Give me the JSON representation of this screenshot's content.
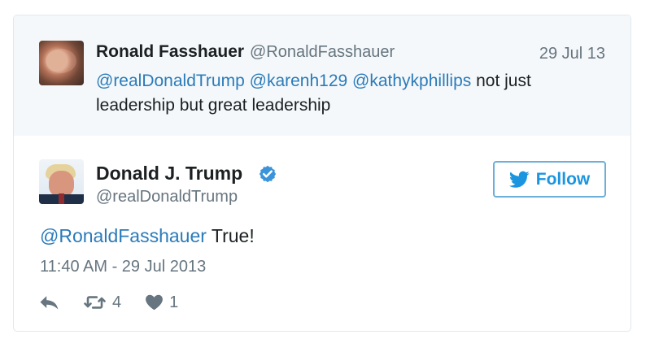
{
  "quoted": {
    "name": "Ronald Fasshauer",
    "handle": "@RonaldFasshauer",
    "date": "29 Jul 13",
    "mentions": [
      "@realDonaldTrump",
      "@karenh129",
      "@kathykphillips"
    ],
    "text_after": "not just",
    "text_line2": "leadership but great leadership"
  },
  "tweet": {
    "name": "Donald J. Trump",
    "handle": "@realDonaldTrump",
    "follow_label": "Follow",
    "reply_mention": "@RonaldFasshauer",
    "text": "True!",
    "timestamp": "11:40 AM - 29 Jul 2013",
    "retweets": "4",
    "likes": "1"
  },
  "icons": {
    "verified": "verified-badge-icon",
    "bird": "twitter-bird-icon",
    "reply": "reply-icon",
    "retweet": "retweet-icon",
    "like": "heart-icon"
  },
  "colors": {
    "link": "#2b7bb9",
    "follow": "#1b95e0",
    "muted": "#66757f"
  }
}
